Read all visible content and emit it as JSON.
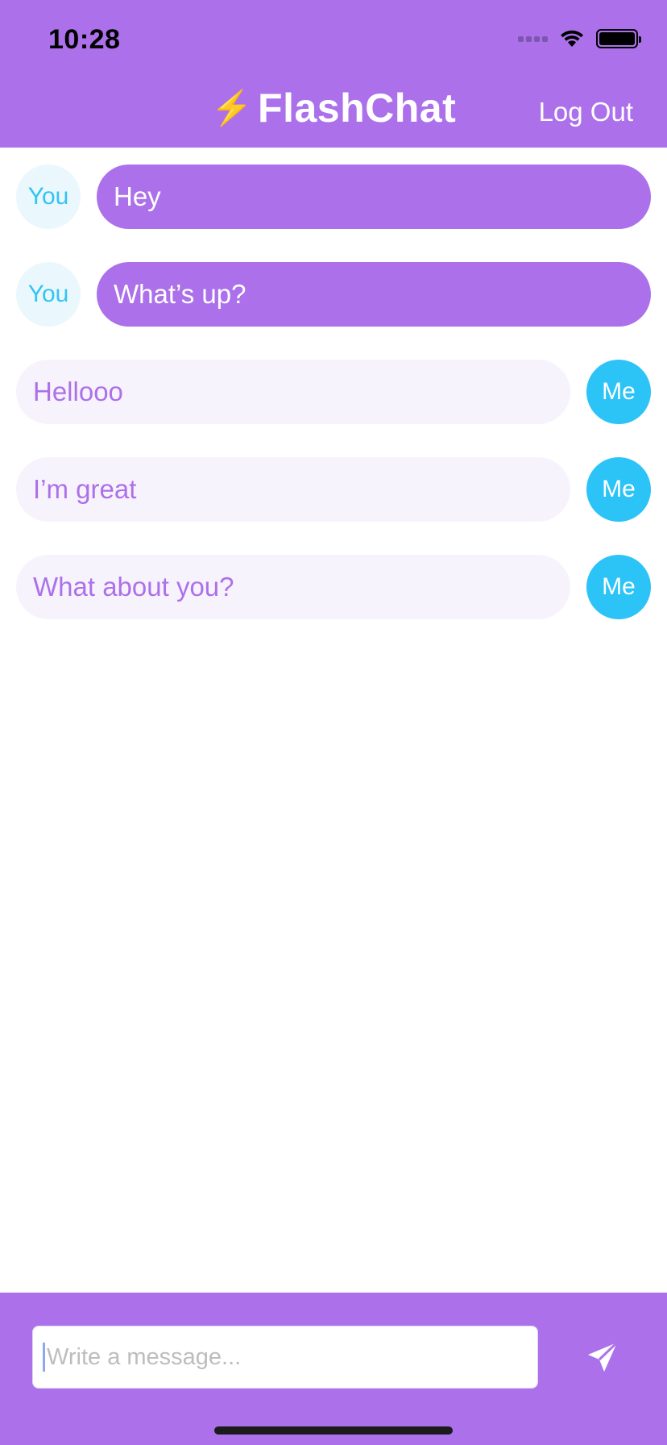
{
  "status_bar": {
    "time": "10:28"
  },
  "nav": {
    "bolt": "⚡",
    "title": "FlashChat",
    "logout_label": "Log Out"
  },
  "messages": [
    {
      "sender": "You",
      "text": "Hey"
    },
    {
      "sender": "You",
      "text": "What’s up?"
    },
    {
      "sender": "Me",
      "text": "Hellooo"
    },
    {
      "sender": "Me",
      "text": "I’m great"
    },
    {
      "sender": "Me",
      "text": "What about you?"
    }
  ],
  "composer": {
    "placeholder": "Write a message...",
    "value": ""
  },
  "colors": {
    "brand": "#AC71EA",
    "me_avatar": "#2CC3F7",
    "you_avatar_bg": "#EAF8FD",
    "me_bubble_bg": "#F7F3FC"
  },
  "icons": {
    "send": "paperplane-icon",
    "wifi": "wifi-icon",
    "battery": "battery-icon",
    "signal": "signal-icon"
  }
}
